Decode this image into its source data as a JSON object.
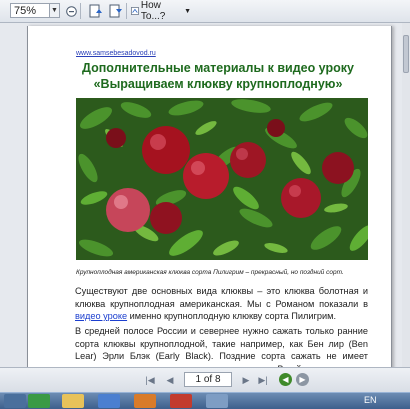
{
  "toolbar": {
    "zoom_value": "75%",
    "howto_label": "How To...?",
    "icons": [
      "chevron-down-icon",
      "zoom-out-icon",
      "zoom-in-icon",
      "page-up-icon",
      "page-down-icon",
      "help-icon"
    ]
  },
  "document": {
    "site_link": "www.samsebesadovod.ru",
    "title_line1": "Дополнительные материалы к видео уроку",
    "title_line2": "«Выращиваем клюкву крупноплодную»",
    "photo_alt": "Крупноплодная американская клюква сорта Пилигрим",
    "caption": "Крупноплодная американская клюква сорта Пилигрим – прекрасный, но поздний сорт.",
    "para1_before": "Существуют две основных вида клюквы – это клюква болотная и клюква крупноплодная американская. Мы с Романом показали в ",
    "para1_link": "видео уроке",
    "para1_after": " именно крупноплодную клюкву сорта Пилигрим.",
    "para2": "В средней полосе России и севернее нужно сажать только ранние сорта клюквы крупноплодной, такие например, как Бен лир (Ben Lear) Эрли Блэк (Early Black). Поздние сорта сажать не имеет смысла, так как их ягоды не успевают созреть. В районах,"
  },
  "navbar": {
    "page_indicator": "1 of 8"
  },
  "taskbar": {
    "language": "EN"
  },
  "colors": {
    "title_green": "#1e6a1e",
    "link_blue": "#1c3fcf",
    "berry_red": "#b81c2c",
    "leaf_green": "#3f8a2a"
  }
}
